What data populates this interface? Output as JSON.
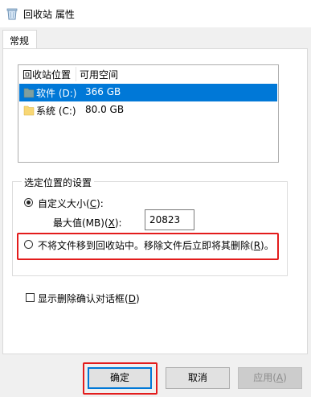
{
  "window": {
    "title": "回收站 属性"
  },
  "tabs": [
    {
      "label": "常规"
    }
  ],
  "list": {
    "headers": {
      "location": "回收站位置",
      "space": "可用空间"
    },
    "rows": [
      {
        "name": "软件 (D:)",
        "space": "366 GB",
        "selected": true
      },
      {
        "name": "系统 (C:)",
        "space": "80.0 GB",
        "selected": false
      }
    ]
  },
  "settings": {
    "group_label": "选定位置的设置",
    "custom_size": {
      "label_pre": "自定义大小(",
      "key": "C",
      "label_post": "):",
      "selected": true
    },
    "max_size": {
      "label_pre": "最大值(MB)(",
      "key": "X",
      "label_post": "):",
      "value": "20823"
    },
    "no_recycle": {
      "label_pre": "不将文件移到回收站中。移除文件后立即将其删除(",
      "key": "R",
      "label_post": ")。",
      "selected": false
    }
  },
  "confirm_dialog": {
    "label_pre": "显示删除确认对话框(",
    "key": "D",
    "label_post": ")",
    "checked": false
  },
  "buttons": {
    "ok": "确定",
    "cancel": "取消",
    "apply_pre": "应用(",
    "apply_key": "A",
    "apply_post": ")"
  },
  "colors": {
    "selection": "#0078d7",
    "highlight_annotation": "#e31c1c",
    "folder": "#f8d775"
  }
}
